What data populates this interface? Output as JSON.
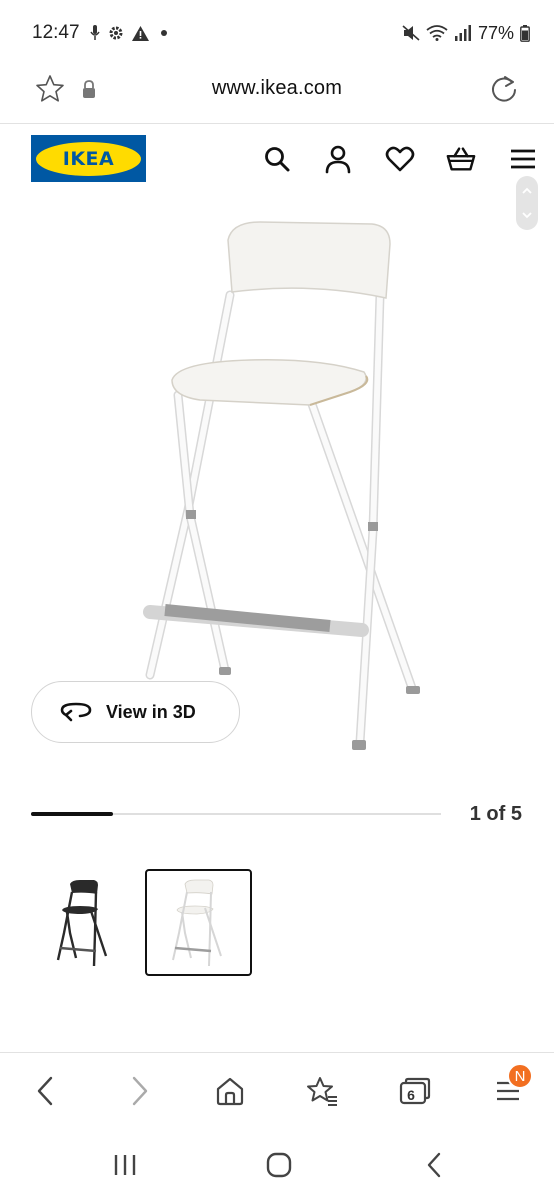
{
  "status_bar": {
    "time": "12:47",
    "left_icons": [
      "microphone-icon",
      "gear-icon",
      "warning-icon",
      "dot-icon"
    ],
    "right_icons": [
      "mute-icon",
      "wifi-icon",
      "signal-icon",
      "battery-icon"
    ],
    "battery_text": "77%"
  },
  "browser": {
    "url": "www.ikea.com",
    "tab_count": "6",
    "notification_badge": "N"
  },
  "header": {
    "logo_text": "IKEA",
    "icons": [
      "search-icon",
      "account-icon",
      "heart-icon",
      "basket-icon",
      "menu-icon"
    ],
    "colors": {
      "logo_blue": "#0058a3",
      "logo_yellow": "#ffdb00"
    }
  },
  "gallery": {
    "view_3d_label": "View in 3D",
    "position_text": "1 of 5",
    "progress_fraction": 0.2,
    "thumbnails": [
      {
        "name": "black-bar-stool-thumb",
        "selected": false
      },
      {
        "name": "white-bar-stool-thumb",
        "selected": true
      }
    ]
  },
  "colors": {
    "accent_orange": "#f26f21",
    "text_dark": "#111111"
  }
}
